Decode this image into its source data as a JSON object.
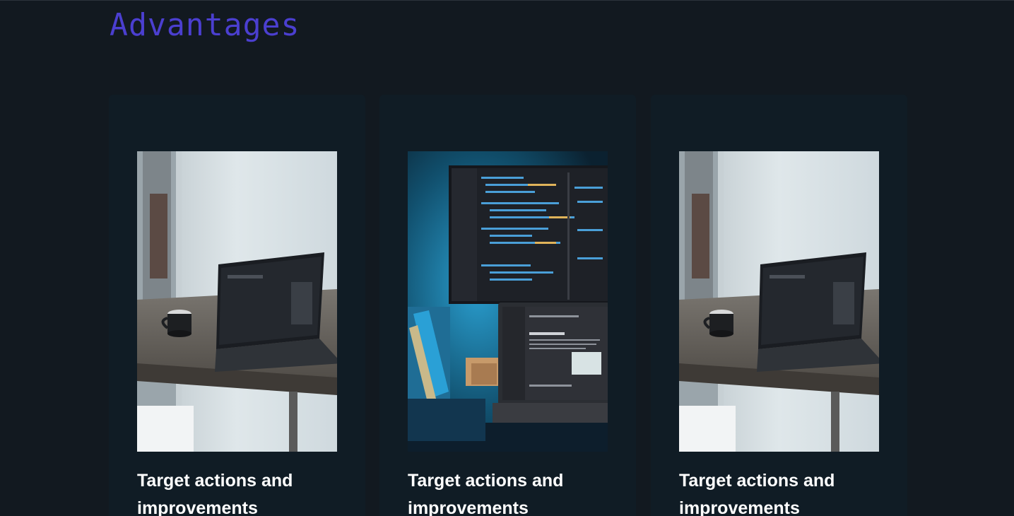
{
  "section": {
    "title": "Advantages"
  },
  "cards": [
    {
      "title": "Target actions and improvements",
      "image": "laptop-desk-photo"
    },
    {
      "title": "Target actions and improvements",
      "image": "code-monitor-photo"
    },
    {
      "title": "Target actions and improvements",
      "image": "laptop-desk-photo"
    }
  ],
  "colors": {
    "background": "#121920",
    "card": "#101c25",
    "title_accent": "#4b3fd0",
    "card_title": "#ffffff"
  }
}
